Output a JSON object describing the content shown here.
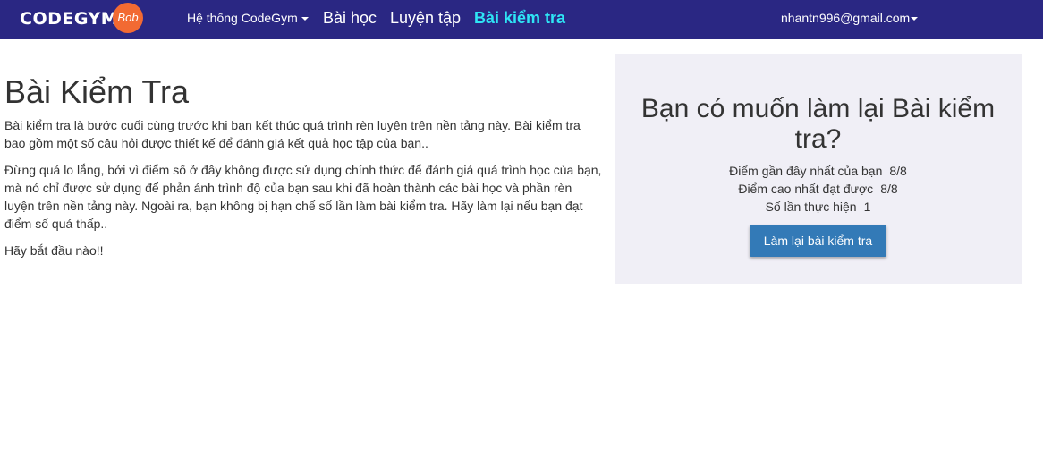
{
  "navbar": {
    "logo_main": "CODEGYM",
    "logo_badge": "Bob",
    "system_menu": "Hệ thống CodeGym",
    "lessons": "Bài học",
    "practice": "Luyện tập",
    "tests": "Bài kiểm tra",
    "user_email": "nhantn996@gmail.com"
  },
  "colors": {
    "navbar_bg": "#2a2783",
    "active_link": "#2ee5f5",
    "logo_badge": "#f26a33",
    "panel_bg": "#f0eff6",
    "button_bg": "#337ab7"
  },
  "main": {
    "title": "Bài Kiểm Tra",
    "paragraph_1": "Bài kiểm tra là bước cuối cùng trước khi bạn kết thúc quá trình rèn luyện trên nền tảng này. Bài kiểm tra bao gồm một số câu hỏi được thiết kế để đánh giá kết quả học tập của bạn..",
    "paragraph_2": "Đừng quá lo lắng, bởi vì điểm số ở đây không được sử dụng chính thức để đánh giá quá trình học của bạn, mà nó chỉ được sử dụng để phản ánh trình độ của bạn sau khi đã hoàn thành các bài học và phần rèn luyện trên nền tảng này. Ngoài ra, bạn không bị hạn chế số lần làm bài kiểm tra. Hãy làm lại nếu bạn đạt điểm số quá thấp..",
    "paragraph_3": "Hãy bắt đầu nào!!"
  },
  "panel": {
    "title": "Bạn có muốn làm lại Bài kiểm tra?",
    "latest_score_label": "Điểm gần đây nhất của bạn",
    "latest_score_value": "8/8",
    "best_score_label": "Điểm cao nhất đạt được",
    "best_score_value": "8/8",
    "attempts_label": "Số lần thực hiện",
    "attempts_value": "1",
    "retry_button": "Làm lại bài kiểm tra"
  }
}
